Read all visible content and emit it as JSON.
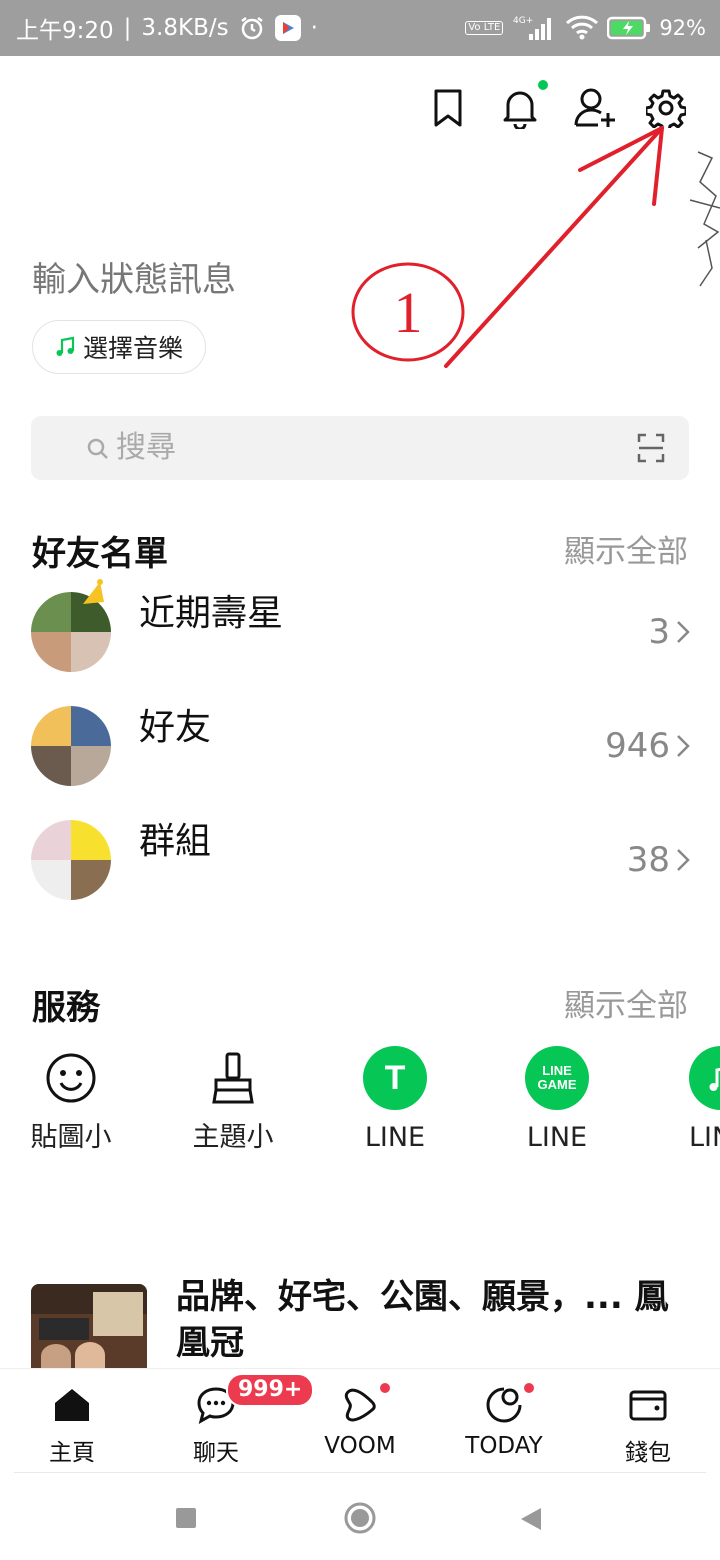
{
  "status_bar": {
    "time": "上午9:20",
    "network_speed": "3.8KB/s",
    "volte": "Vo LTE",
    "signal_type": "4G+",
    "battery": "92%"
  },
  "status_message": {
    "placeholder": "輸入狀態訊息",
    "music_label": "選擇音樂"
  },
  "search": {
    "placeholder": "搜尋"
  },
  "friends": {
    "title": "好友名單",
    "show_all": "顯示全部",
    "rows": [
      {
        "label": "近期壽星",
        "count": "3"
      },
      {
        "label": "好友",
        "count": "946"
      },
      {
        "label": "群組",
        "count": "38"
      }
    ]
  },
  "services": {
    "title": "服務",
    "show_all": "顯示全部",
    "items": [
      {
        "label": "貼圖小",
        "icon": "smiley-icon"
      },
      {
        "label": "主題小",
        "icon": "brush-icon"
      },
      {
        "label": "LINE",
        "icon": "line-taxi-icon",
        "badge_text": "T"
      },
      {
        "label": "LINE",
        "icon": "line-game-icon",
        "badge_text": "LINE GAME"
      },
      {
        "label": "LIN",
        "icon": "line-music-icon"
      }
    ]
  },
  "news": {
    "title": "品牌、好宅、公園、願景，... 鳳凰冠"
  },
  "bottom_nav": {
    "items": [
      {
        "label": "主頁",
        "icon": "home-icon"
      },
      {
        "label": "聊天",
        "icon": "chat-icon",
        "badge": "999+"
      },
      {
        "label": "VOOM",
        "icon": "voom-icon"
      },
      {
        "label": "TODAY",
        "icon": "today-icon"
      },
      {
        "label": "錢包",
        "icon": "wallet-icon"
      }
    ]
  },
  "annotation": {
    "marker": "1",
    "color": "#e0202a"
  }
}
